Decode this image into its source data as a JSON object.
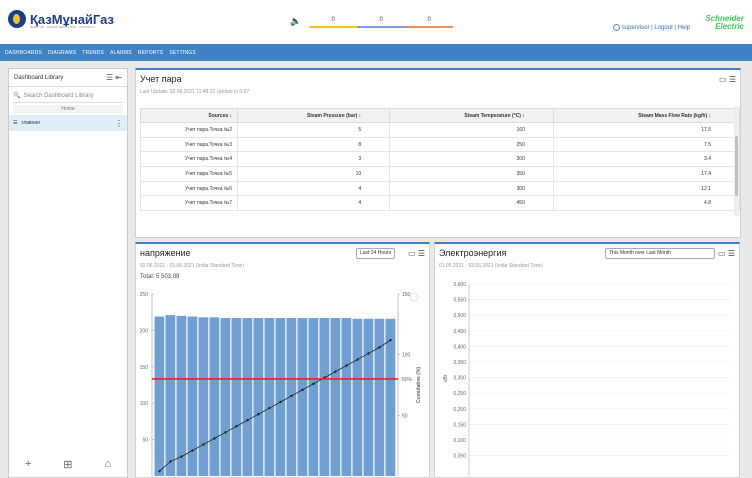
{
  "header": {
    "logo_text": "ҚазМұнайГаз",
    "logo_tagline": "ЭНЕРГИЯ · ВЗАИМОДЕЙСТВИЕ · ПРОГРЕСС",
    "alarm_counts": [
      "0",
      "0",
      "0"
    ],
    "alarm_colors": [
      "#f7c518",
      "#7a9fe0",
      "#f08c5a"
    ],
    "user": "supervisor",
    "logout": "Logout",
    "help": "Help",
    "brand_line1": "Schneider",
    "brand_line2": "Electric"
  },
  "nav": [
    "DASHBOARDS",
    "DIAGRAMS",
    "TRENDS",
    "ALARMS",
    "REPORTS",
    "SETTINGS"
  ],
  "sidebar": {
    "title": "Dashboard Library",
    "search_placeholder": "Search Dashboard Library",
    "section": "Home",
    "items": [
      {
        "label": "главная"
      }
    ]
  },
  "steam_panel": {
    "title": "Учет пара",
    "subtitle": "Last Update: 03.06.2021 11:48:32  Update in 0:57",
    "columns": [
      "Sources",
      "Steam Pressure (bar)",
      "Steam Temperature (°C)",
      "Steam Mass Flow Rate (kg/h)"
    ],
    "rows": [
      [
        "Учет пара.Точка №2",
        "5",
        "160",
        "17.5"
      ],
      [
        "Учет пара.Точка №3",
        "8",
        "250",
        "7.5"
      ],
      [
        "Учет пара.Точка №4",
        "3",
        "300",
        "3.4"
      ],
      [
        "Учет пара.Точка №5",
        "10",
        "350",
        "17.4"
      ],
      [
        "Учет пара.Точка №6",
        "4",
        "300",
        "12.1"
      ],
      [
        "Учет пара.Точка №7",
        "4",
        "450",
        "4.8"
      ]
    ]
  },
  "voltage_panel": {
    "title": "напряжение",
    "subtitle": "02.06.2021 - 03.06.2021 (India Standard Time)",
    "total": "Total: 5 503,09",
    "range": "Last 24 Hours",
    "y2_label": "Cumulative (%)",
    "threshold_label": "80%",
    "chart_data": {
      "type": "bar",
      "ylim": [
        0,
        250
      ],
      "y_ticks": [
        "250",
        "200",
        "150",
        "100",
        "50"
      ],
      "y2_ticks": [
        "150",
        "100",
        "50"
      ],
      "values": [
        219,
        221,
        220,
        219,
        218,
        218,
        217,
        217,
        217,
        217,
        217,
        217,
        217,
        217,
        217,
        217,
        217,
        217,
        216,
        216,
        216,
        216
      ],
      "cumulative_percent": [
        4,
        12,
        16,
        21,
        26,
        31,
        36,
        41,
        46,
        51,
        56,
        61,
        66,
        71,
        76,
        81,
        86,
        91,
        96,
        101,
        106,
        112
      ],
      "threshold": 80,
      "colors": {
        "bar": "#6f9fd3",
        "line": "#222222",
        "threshold": "#ee2222"
      }
    }
  },
  "energy_panel": {
    "title": "Электроэнергия",
    "subtitle": "01.05.2021 - 03.06.2021 (India Standard Time)",
    "range": "This Month over Last Month",
    "ylabel": "кВт",
    "chart_data": {
      "type": "bar",
      "y_ticks": [
        "0,600",
        "0,550",
        "0,500",
        "0,450",
        "0,400",
        "0,350",
        "0,300",
        "0,250",
        "0,200",
        "0,150",
        "0,100",
        "0,050"
      ],
      "values": []
    }
  }
}
